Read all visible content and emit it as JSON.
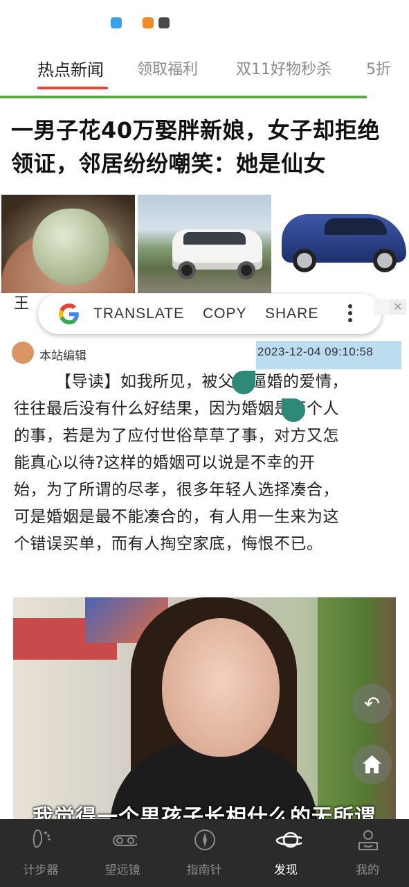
{
  "tabs": [
    {
      "label": "热点新闻",
      "active": true
    },
    {
      "label": "领取福利",
      "active": false
    },
    {
      "label": "双11好物秒杀",
      "active": false
    },
    {
      "label": "5折",
      "active": false
    }
  ],
  "article": {
    "headline": "一男子花40万娶胖新娘，女子却拒绝领证，邻居纷纷嘲笑：她是仙女",
    "hidden_peek": "王",
    "author": "本站编辑",
    "timestamp": "2023-12-04 09:10:58",
    "lines": [
      "【导读】如我所见，被父母逼婚的爱情，",
      "往往最后没有什么好结果，因为婚姻是两个人",
      "的事，若是为了应付世俗草草了事，对方又怎",
      "能真心以待?这样的婚姻可以说是不幸的开",
      "始，为了所谓的尽孝，很多年轻人选择凑合，",
      "可是婚姻是最不能凑合的，有人用一生来为这",
      "个错误买单，而有人掏空家底，悔恨不已。"
    ],
    "photo_caption": "我觉得一个男孩子长相什么的无所谓"
  },
  "selection_popup": {
    "translate": "TRANSLATE",
    "copy": "COPY",
    "share": "SHARE",
    "close": "✕"
  },
  "float_buttons": {
    "back_icon": "↶"
  },
  "bottom_nav": [
    {
      "label": "计步器",
      "icon": "footprint-icon",
      "active": false
    },
    {
      "label": "望远镜",
      "icon": "binoculars-icon",
      "active": false
    },
    {
      "label": "指南针",
      "icon": "compass-icon",
      "active": false
    },
    {
      "label": "发现",
      "icon": "planet-icon",
      "active": true
    },
    {
      "label": "我的",
      "icon": "profile-icon",
      "active": false
    }
  ],
  "colors": {
    "tab_underline": "#e0483c",
    "green_rule": "#58a843",
    "selection": "#bcdcf0",
    "selection_handle": "#2d8a78",
    "bottom_nav_bg": "#2b2b2b"
  }
}
